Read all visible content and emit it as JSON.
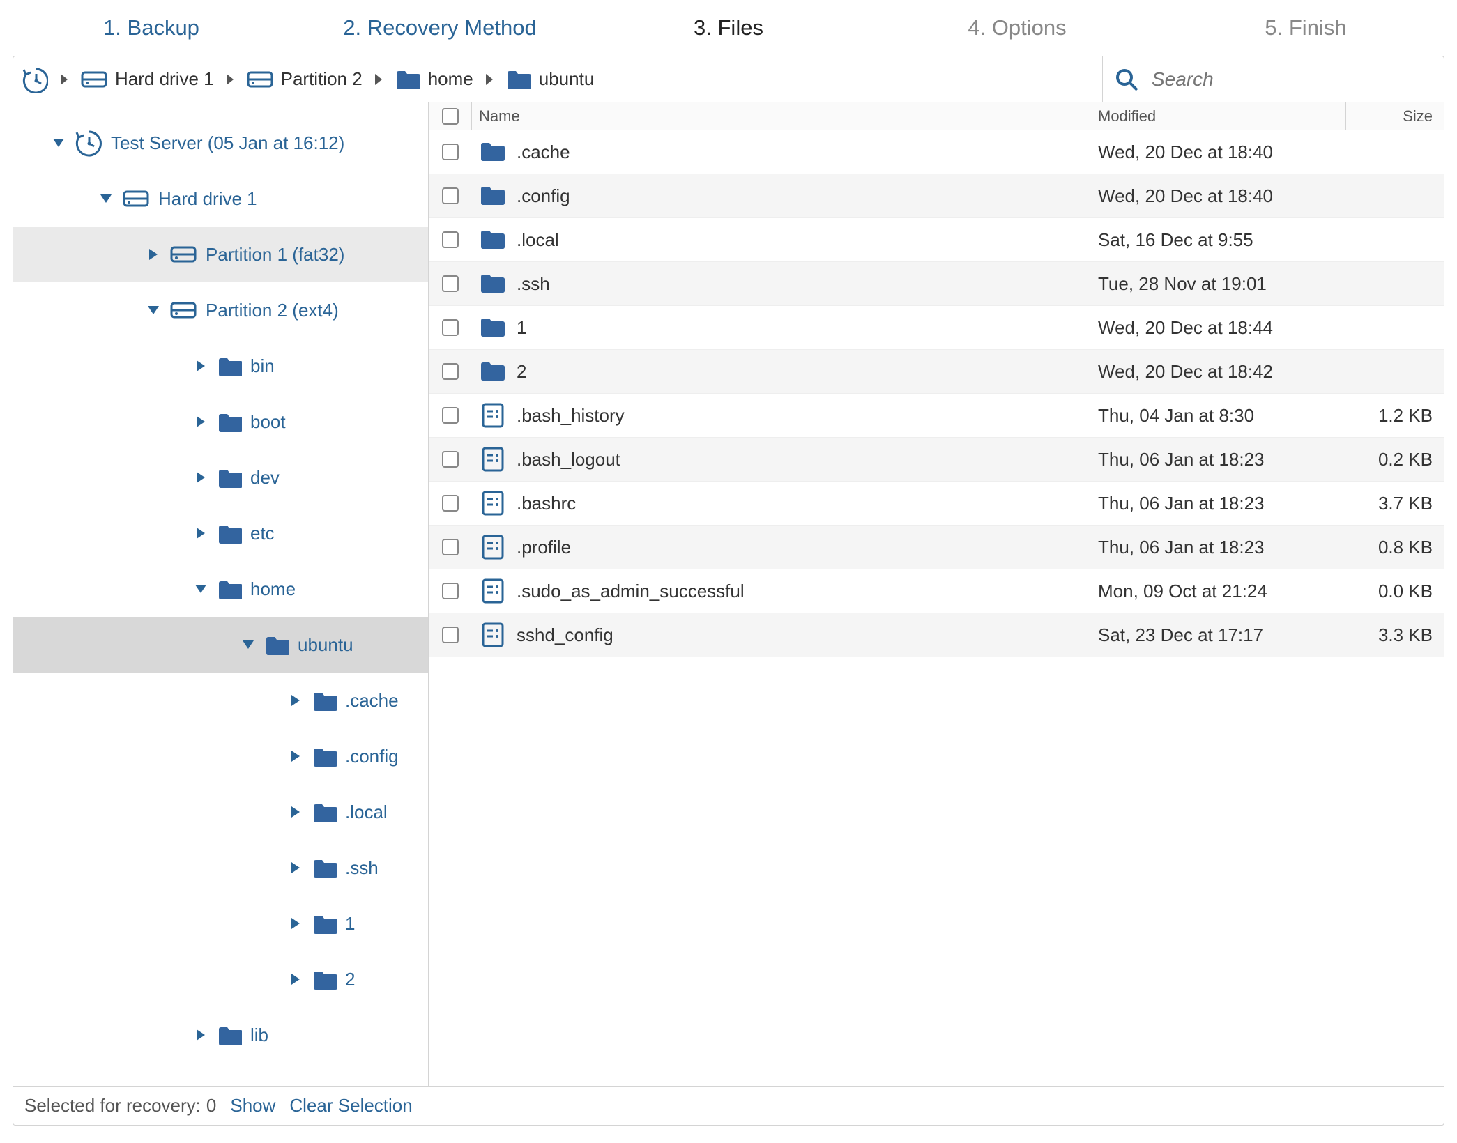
{
  "wizard": {
    "steps": [
      {
        "label": "1. Backup",
        "state": "done"
      },
      {
        "label": "2. Recovery Method",
        "state": "done"
      },
      {
        "label": "3. Files",
        "state": "active"
      },
      {
        "label": "4. Options",
        "state": "future"
      },
      {
        "label": "5. Finish",
        "state": "future"
      }
    ]
  },
  "breadcrumb": {
    "items": [
      {
        "icon": "drive",
        "label": "Hard drive 1"
      },
      {
        "icon": "drive",
        "label": "Partition 2"
      },
      {
        "icon": "folder",
        "label": "home"
      },
      {
        "icon": "folder",
        "label": "ubuntu"
      }
    ]
  },
  "search": {
    "placeholder": "Search"
  },
  "tree": {
    "root_label": "Test Server (05 Jan at 16:12)",
    "drive_label": "Hard drive 1",
    "partitions": [
      {
        "label": "Partition 1 (fat32)",
        "expanded": false,
        "selected": true
      },
      {
        "label": "Partition 2 (ext4)",
        "expanded": true,
        "selected": false,
        "children": [
          {
            "label": "bin",
            "expanded": false
          },
          {
            "label": "boot",
            "expanded": false
          },
          {
            "label": "dev",
            "expanded": false
          },
          {
            "label": "etc",
            "expanded": false
          },
          {
            "label": "home",
            "expanded": true,
            "children": [
              {
                "label": "ubuntu",
                "expanded": true,
                "selected": true,
                "children": [
                  {
                    "label": ".cache"
                  },
                  {
                    "label": ".config"
                  },
                  {
                    "label": ".local"
                  },
                  {
                    "label": ".ssh"
                  },
                  {
                    "label": "1"
                  },
                  {
                    "label": "2"
                  }
                ]
              }
            ]
          },
          {
            "label": "lib",
            "expanded": false
          }
        ]
      }
    ]
  },
  "columns": {
    "name": "Name",
    "modified": "Modified",
    "size": "Size"
  },
  "files": [
    {
      "type": "folder",
      "name": ".cache",
      "modified": "Wed, 20 Dec at 18:40",
      "size": ""
    },
    {
      "type": "folder",
      "name": ".config",
      "modified": "Wed, 20 Dec at 18:40",
      "size": ""
    },
    {
      "type": "folder",
      "name": ".local",
      "modified": "Sat, 16 Dec at 9:55",
      "size": ""
    },
    {
      "type": "folder",
      "name": ".ssh",
      "modified": "Tue, 28 Nov at 19:01",
      "size": ""
    },
    {
      "type": "folder",
      "name": "1",
      "modified": "Wed, 20 Dec at 18:44",
      "size": ""
    },
    {
      "type": "folder",
      "name": "2",
      "modified": "Wed, 20 Dec at 18:42",
      "size": ""
    },
    {
      "type": "file",
      "name": ".bash_history",
      "modified": "Thu, 04 Jan at 8:30",
      "size": "1.2 KB"
    },
    {
      "type": "file",
      "name": ".bash_logout",
      "modified": "Thu, 06 Jan at 18:23",
      "size": "0.2 KB"
    },
    {
      "type": "file",
      "name": ".bashrc",
      "modified": "Thu, 06 Jan at 18:23",
      "size": "3.7 KB"
    },
    {
      "type": "file",
      "name": ".profile",
      "modified": "Thu, 06 Jan at 18:23",
      "size": "0.8 KB"
    },
    {
      "type": "file",
      "name": ".sudo_as_admin_successful",
      "modified": "Mon, 09 Oct at 21:24",
      "size": "0.0 KB"
    },
    {
      "type": "file",
      "name": "sshd_config",
      "modified": "Sat, 23 Dec at 17:17",
      "size": "3.3 KB"
    }
  ],
  "footer": {
    "selected_label": "Selected for recovery:",
    "selected_count": "0",
    "show_label": "Show",
    "clear_label": "Clear Selection"
  }
}
